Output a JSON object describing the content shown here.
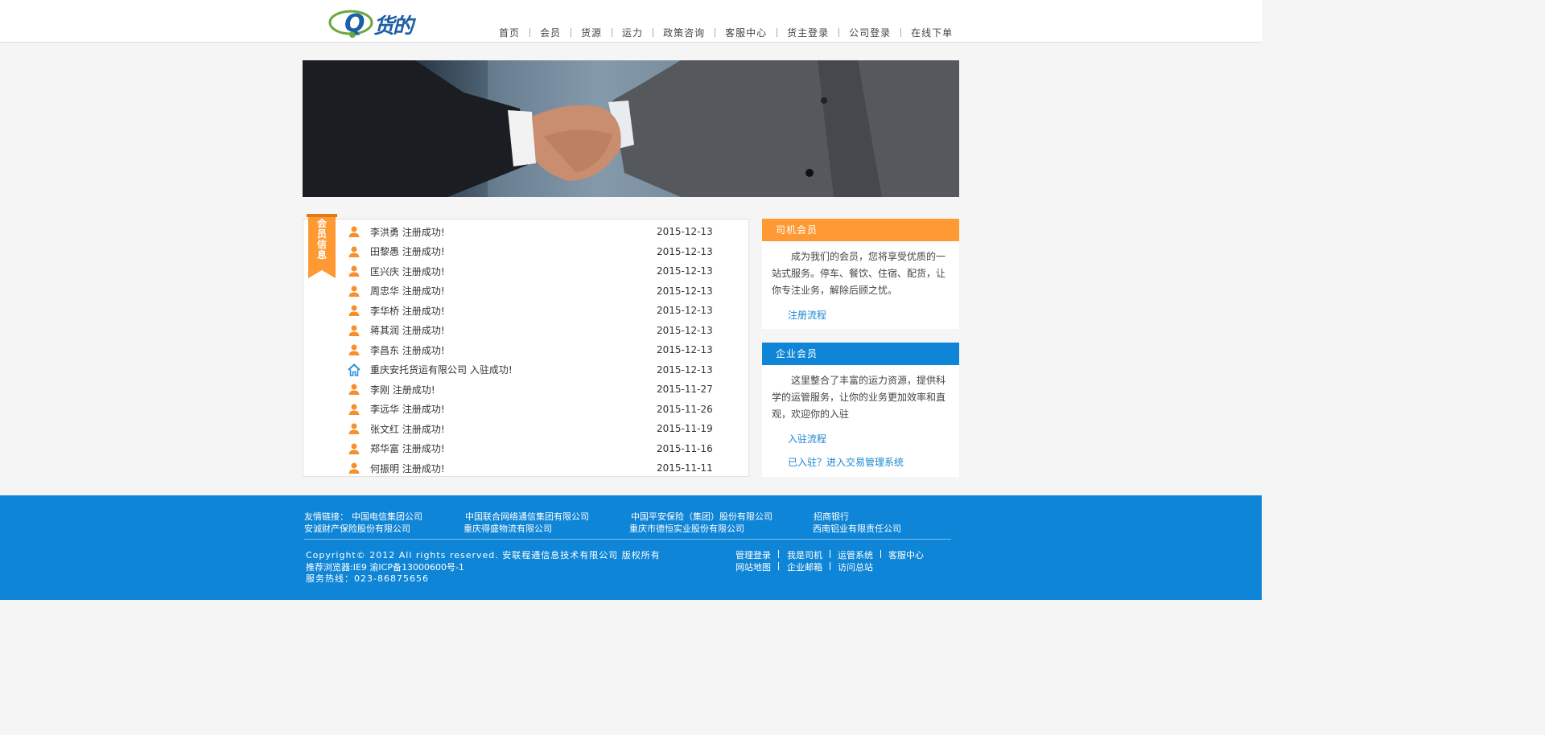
{
  "header": {
    "logo_text": "货的",
    "logo_letter": "Q",
    "nav": [
      "首页",
      "会员",
      "货源",
      "运力",
      "政策咨询",
      "客服中心",
      "货主登录",
      "公司登录",
      "在线下单"
    ]
  },
  "members": {
    "ribbon_label": "会员信息",
    "items": [
      {
        "name": "李洪勇  注册成功!",
        "date": "2015-12-13",
        "icon": "person-icon"
      },
      {
        "name": "田黎愚  注册成功!",
        "date": "2015-12-13",
        "icon": "person-icon"
      },
      {
        "name": "匡兴庆  注册成功!",
        "date": "2015-12-13",
        "icon": "person-icon"
      },
      {
        "name": "周忠华  注册成功!",
        "date": "2015-12-13",
        "icon": "person-icon"
      },
      {
        "name": "李华桥  注册成功!",
        "date": "2015-12-13",
        "icon": "person-icon"
      },
      {
        "name": "蒋其润  注册成功!",
        "date": "2015-12-13",
        "icon": "person-icon"
      },
      {
        "name": "李昌东  注册成功!",
        "date": "2015-12-13",
        "icon": "person-icon"
      },
      {
        "name": "重庆安托货运有限公司  入驻成功!",
        "date": "2015-12-13",
        "icon": "house-icon"
      },
      {
        "name": "李刚  注册成功!",
        "date": "2015-11-27",
        "icon": "person-icon"
      },
      {
        "name": "李远华  注册成功!",
        "date": "2015-11-26",
        "icon": "person-icon"
      },
      {
        "name": "张文红  注册成功!",
        "date": "2015-11-19",
        "icon": "person-icon"
      },
      {
        "name": "郑华富  注册成功!",
        "date": "2015-11-16",
        "icon": "person-icon"
      },
      {
        "name": "何振明  注册成功!",
        "date": "2015-11-11",
        "icon": "person-icon"
      }
    ]
  },
  "driver_box": {
    "title": "司机会员",
    "body": "成为我们的会员，您将享受优质的一站式服务。停车、餐饮、住宿、配货，让你专注业务，解除后顾之忧。",
    "link": "注册流程"
  },
  "company_box": {
    "title": "企业会员",
    "body": "这里整合了丰富的运力资源，提供科学的运管服务，让你的业务更加效率和直观，欢迎你的入驻",
    "link1": "入驻流程",
    "link2": "已入驻？进入交易管理系统"
  },
  "footer": {
    "friend_label": "友情链接：",
    "friends": [
      "中国电信集团公司",
      "中国联合网络通信集团有限公司",
      "中国平安保险（集团）股份有限公司",
      "招商银行",
      "安诚财产保险股份有限公司",
      "重庆得盛物流有限公司",
      "重庆市德恒实业股份有限公司",
      "西南铝业有限责任公司"
    ],
    "copyright": "Copyright© 2012 All rights reserved. 安联程通信息技术有限公司 版权所有",
    "browser": "推荐浏览器:IE9  渝ICP备13000600号-1",
    "hotline": "服务热线：023-86875656",
    "links": [
      "管理登录",
      "我是司机",
      "运管系统",
      "客服中心",
      "网站地图",
      "企业邮箱",
      "访问总站"
    ]
  },
  "colors": {
    "orange": "#ff9933",
    "blue": "#0e85d6",
    "link": "#1a87d3"
  }
}
